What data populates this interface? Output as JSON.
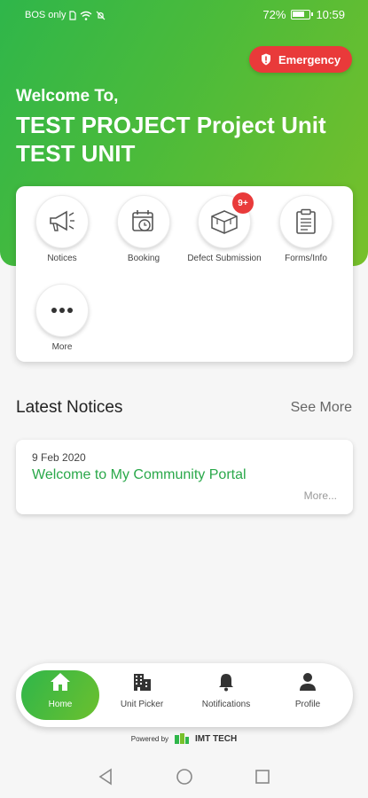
{
  "status_bar": {
    "carrier": "BOS only",
    "battery": "72%",
    "time": "10:59"
  },
  "emergency": {
    "label": "Emergency",
    "icon": "shield-icon"
  },
  "header": {
    "welcome": "Welcome To,",
    "project": "TEST PROJECT Project Unit TEST UNIT"
  },
  "menu": {
    "items": [
      {
        "label": "Notices",
        "icon": "megaphone-icon"
      },
      {
        "label": "Booking",
        "icon": "calendar-clock-icon"
      },
      {
        "label": "Defect Submission",
        "icon": "box-icon",
        "badge": "9+"
      },
      {
        "label": "Forms/Info",
        "icon": "clipboard-icon"
      },
      {
        "label": "More",
        "icon": "more-dots-icon"
      }
    ]
  },
  "notices": {
    "title": "Latest Notices",
    "see_more": "See More",
    "items": [
      {
        "date": "9 Feb 2020",
        "title": "Welcome to My Community Portal",
        "more": "More..."
      }
    ]
  },
  "bottom_nav": {
    "items": [
      {
        "label": "Home",
        "icon": "home-icon",
        "active": true
      },
      {
        "label": "Unit Picker",
        "icon": "building-icon"
      },
      {
        "label": "Notifications",
        "icon": "bell-icon"
      },
      {
        "label": "Profile",
        "icon": "person-icon"
      }
    ]
  },
  "footer": {
    "powered_by": "Powered by",
    "brand": "IMT TECH"
  },
  "colors": {
    "brand_green": "#2fb64a",
    "brand_lime": "#78c02a",
    "emergency_red": "#e93a3a",
    "link_green": "#2aa84a"
  }
}
